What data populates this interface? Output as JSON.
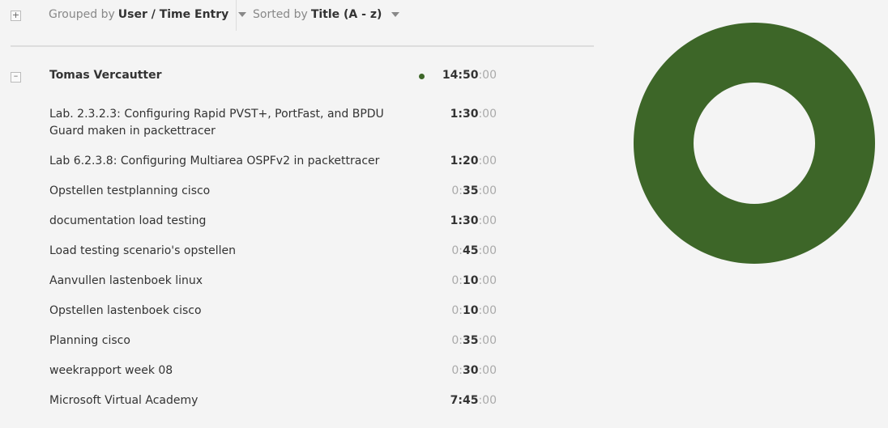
{
  "toolbar": {
    "expand_symbol": "+",
    "group_prefix": "Grouped by",
    "group_value": "User / Time Entry",
    "sort_prefix": "Sorted by",
    "sort_value": "Title (A - z)"
  },
  "group": {
    "collapse_symbol": "–",
    "user": "Tomas Vercautter",
    "dot_color": "#3d6628",
    "total": {
      "h": "14",
      "m": "50",
      "s": "00"
    }
  },
  "entries": [
    {
      "title": "Lab. 2.3.2.3: Configuring Rapid PVST+, PortFast, and BPDU Guard maken in packettracer",
      "h": "1",
      "m": "30",
      "s": "00",
      "bold_hours": true
    },
    {
      "title": "Lab 6.2.3.8: Configuring Multiarea OSPFv2 in packettracer",
      "h": "1",
      "m": "20",
      "s": "00",
      "bold_hours": true
    },
    {
      "title": "Opstellen testplanning cisco",
      "h": "0",
      "m": "35",
      "s": "00",
      "bold_hours": false
    },
    {
      "title": "documentation load testing",
      "h": "1",
      "m": "30",
      "s": "00",
      "bold_hours": true
    },
    {
      "title": "Load testing scenario's opstellen",
      "h": "0",
      "m": "45",
      "s": "00",
      "bold_hours": false
    },
    {
      "title": "Aanvullen lastenboek linux",
      "h": "0",
      "m": "10",
      "s": "00",
      "bold_hours": false
    },
    {
      "title": "Opstellen lastenboek cisco",
      "h": "0",
      "m": "10",
      "s": "00",
      "bold_hours": false
    },
    {
      "title": "Planning cisco",
      "h": "0",
      "m": "35",
      "s": "00",
      "bold_hours": false
    },
    {
      "title": "weekrapport week 08",
      "h": "0",
      "m": "30",
      "s": "00",
      "bold_hours": false
    },
    {
      "title": "Microsoft Virtual Academy",
      "h": "7",
      "m": "45",
      "s": "00",
      "bold_hours": true
    }
  ],
  "chart_data": {
    "type": "pie",
    "donut": true,
    "values": [
      1
    ],
    "colors": [
      "#3d6628"
    ]
  }
}
